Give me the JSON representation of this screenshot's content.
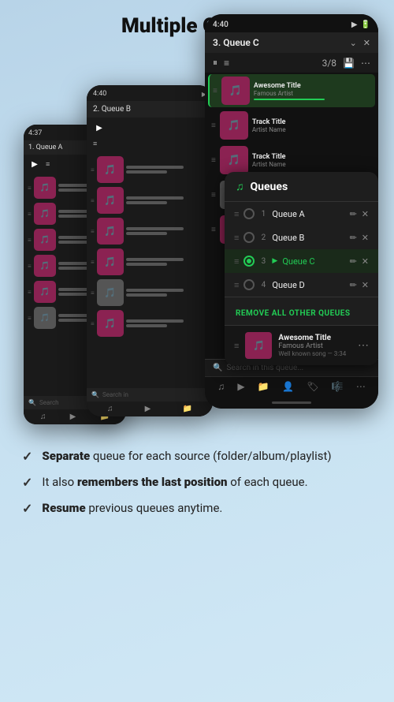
{
  "header": {
    "title": "Multiple Queues"
  },
  "phone1": {
    "time": "4:37",
    "queue_label": "1. Queue A"
  },
  "phone2": {
    "time": "4:40",
    "queue_label": "2. Queue B"
  },
  "phone3": {
    "time": "4:40",
    "queue_label": "3. Queue C",
    "controls_count": "3/8",
    "search_placeholder": "Search in this queue..."
  },
  "queues_popup": {
    "title": "Queues",
    "items": [
      {
        "num": "1",
        "name": "Queue A",
        "active": false
      },
      {
        "num": "2",
        "name": "Queue B",
        "active": false
      },
      {
        "num": "3",
        "name": "Queue C",
        "active": true
      },
      {
        "num": "4",
        "name": "Queue D",
        "active": false
      }
    ],
    "remove_label": "REMOVE ALL OTHER QUEUES",
    "now_playing": {
      "title": "Awesome Title",
      "artist": "Famous Artist",
      "time": "Well known song — 3:34"
    }
  },
  "features": [
    {
      "text_parts": [
        {
          "bold": true,
          "text": "Separate"
        },
        {
          "bold": false,
          "text": " queue for each source (folder/album/playlist)"
        }
      ]
    },
    {
      "text_parts": [
        {
          "bold": false,
          "text": "It also "
        },
        {
          "bold": true,
          "text": "remembers the last position"
        },
        {
          "bold": false,
          "text": " of each queue."
        }
      ]
    },
    {
      "text_parts": [
        {
          "bold": true,
          "text": "Resume"
        },
        {
          "bold": false,
          "text": " previous queues anytime."
        }
      ]
    }
  ]
}
